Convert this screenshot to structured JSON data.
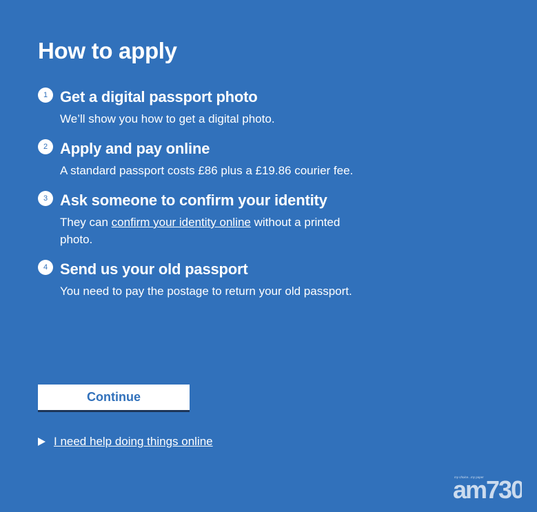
{
  "heading": "How to apply",
  "steps": [
    {
      "number": "1",
      "title": "Get a digital passport photo",
      "body": "We’ll show you how to get a digital photo."
    },
    {
      "number": "2",
      "title": "Apply and pay online",
      "body": "A standard passport costs £86 plus a £19.86 courier fee."
    },
    {
      "number": "3",
      "title": "Ask someone to confirm your identity",
      "body_before": "They can ",
      "link": "confirm your identity online",
      "body_after": " without a printed photo."
    },
    {
      "number": "4",
      "title": "Send us your old passport",
      "body": "You need to pay the postage to return your old passport."
    }
  ],
  "continue_label": "Continue",
  "help_link": "I need help doing things online",
  "watermark": {
    "tagline": "my choice...my paper",
    "brand": "am730"
  },
  "colors": {
    "background": "#3171bb",
    "text": "#ffffff",
    "button_text": "#3171bb",
    "button_shadow": "#1d3557"
  }
}
